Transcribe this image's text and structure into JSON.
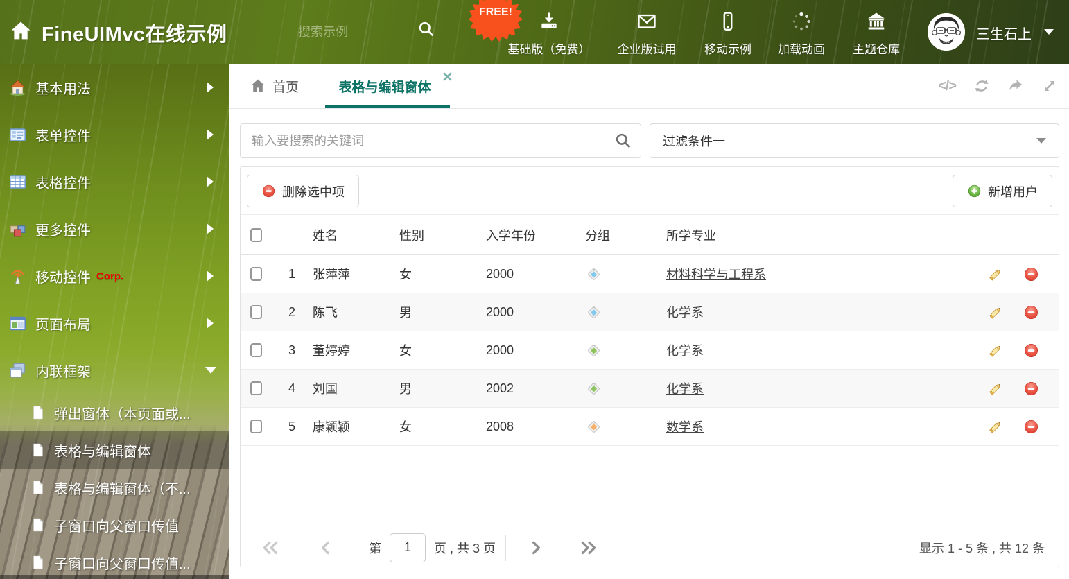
{
  "header": {
    "title": "FineUIMvc在线示例",
    "search_placeholder": "搜索示例",
    "free_badge": "FREE!",
    "nav_items": [
      {
        "label": "基础版（免费）",
        "icon": "download-icon"
      },
      {
        "label": "企业版试用",
        "icon": "envelope-icon"
      },
      {
        "label": "移动示例",
        "icon": "mobile-icon"
      },
      {
        "label": "加载动画",
        "icon": "spinner-icon"
      },
      {
        "label": "主题仓库",
        "icon": "bank-icon"
      }
    ],
    "user": {
      "name": "三生石上"
    }
  },
  "sidebar": {
    "items": [
      {
        "label": "基本用法",
        "icon": "house-icon"
      },
      {
        "label": "表单控件",
        "icon": "form-icon"
      },
      {
        "label": "表格控件",
        "icon": "grid-icon"
      },
      {
        "label": "更多控件",
        "icon": "cubes-icon"
      },
      {
        "label": "移动控件",
        "badge": "Corp.",
        "icon": "antenna-icon"
      },
      {
        "label": "页面布局",
        "icon": "layout-icon"
      },
      {
        "label": "内联框架",
        "icon": "frames-icon",
        "expanded": true,
        "children": [
          "弹出窗体（本页面或...",
          "表格与编辑窗体",
          "表格与编辑窗体（不...",
          "子窗口向父窗口传值",
          "子窗口向父窗口传值..."
        ]
      }
    ],
    "selected_child": "表格与编辑窗体"
  },
  "tabs": [
    {
      "label": "首页",
      "icon": "home-icon"
    },
    {
      "label": "表格与编辑窗体",
      "active": true,
      "closable": true
    }
  ],
  "main": {
    "search": {
      "placeholder": "输入要搜索的关键词"
    },
    "filter": {
      "value": "过滤条件一"
    },
    "toolbar": {
      "delete_label": "删除选中项",
      "add_label": "新增用户"
    },
    "table": {
      "columns": [
        "姓名",
        "性别",
        "入学年份",
        "分组",
        "所学专业"
      ],
      "rows": [
        {
          "num": "1",
          "name": "张萍萍",
          "gender": "女",
          "year": "2000",
          "tag_color": "#85c9ef",
          "major": "材料科学与工程系"
        },
        {
          "num": "2",
          "name": "陈飞",
          "gender": "男",
          "year": "2000",
          "tag_color": "#85c9ef",
          "major": "化学系"
        },
        {
          "num": "3",
          "name": "董婷婷",
          "gender": "女",
          "year": "2000",
          "tag_color": "#8dc45e",
          "major": "化学系"
        },
        {
          "num": "4",
          "name": "刘国",
          "gender": "男",
          "year": "2002",
          "tag_color": "#8dc45e",
          "major": "化学系"
        },
        {
          "num": "5",
          "name": "康颖颖",
          "gender": "女",
          "year": "2008",
          "tag_color": "#f6b26b",
          "major": "数学系"
        }
      ]
    },
    "pagination": {
      "prefix": "第",
      "page": "1",
      "suffix": "页 , 共 3 页",
      "summary": "显示 1 - 5 条 , 共 12 条"
    }
  },
  "colors": {
    "accent_teal": "#0c7266",
    "free_badge_orange": "#ff4d17",
    "corp_red": "#f40000",
    "delete_red": "#e2362a",
    "add_green": "#5aa32e"
  }
}
